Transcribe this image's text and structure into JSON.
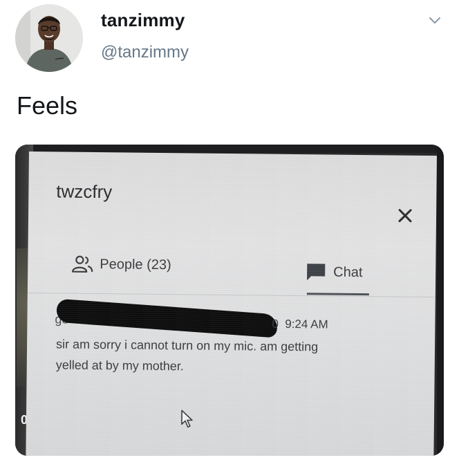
{
  "tweet": {
    "display_name": "tanzimmy",
    "handle": "@tanzimmy",
    "text": "Feels",
    "avatar_icon": "profile-photo",
    "menu_icon": "chevron-down-icon"
  },
  "photo": {
    "left_edge_digit": "0",
    "meet_panel": {
      "meeting_code": "twzcfry",
      "close_icon": "close-icon",
      "tabs": [
        {
          "icon": "people-icon",
          "label": "People (23)"
        },
        {
          "icon": "chat-bubble-icon",
          "label": "Chat",
          "active": true
        }
      ],
      "message": {
        "sender_visible": "go",
        "time": "0  9:24 AM",
        "lines": [
          "sir am sorry i cannot turn on my mic. am getting",
          "yelled at by my mother."
        ]
      },
      "cursor_icon": "mouse-pointer-icon"
    }
  },
  "colors": {
    "handle": "#657786",
    "text": "#14171a",
    "panel_bg": "#e0e0e1",
    "redaction": "#0b0b0b"
  }
}
